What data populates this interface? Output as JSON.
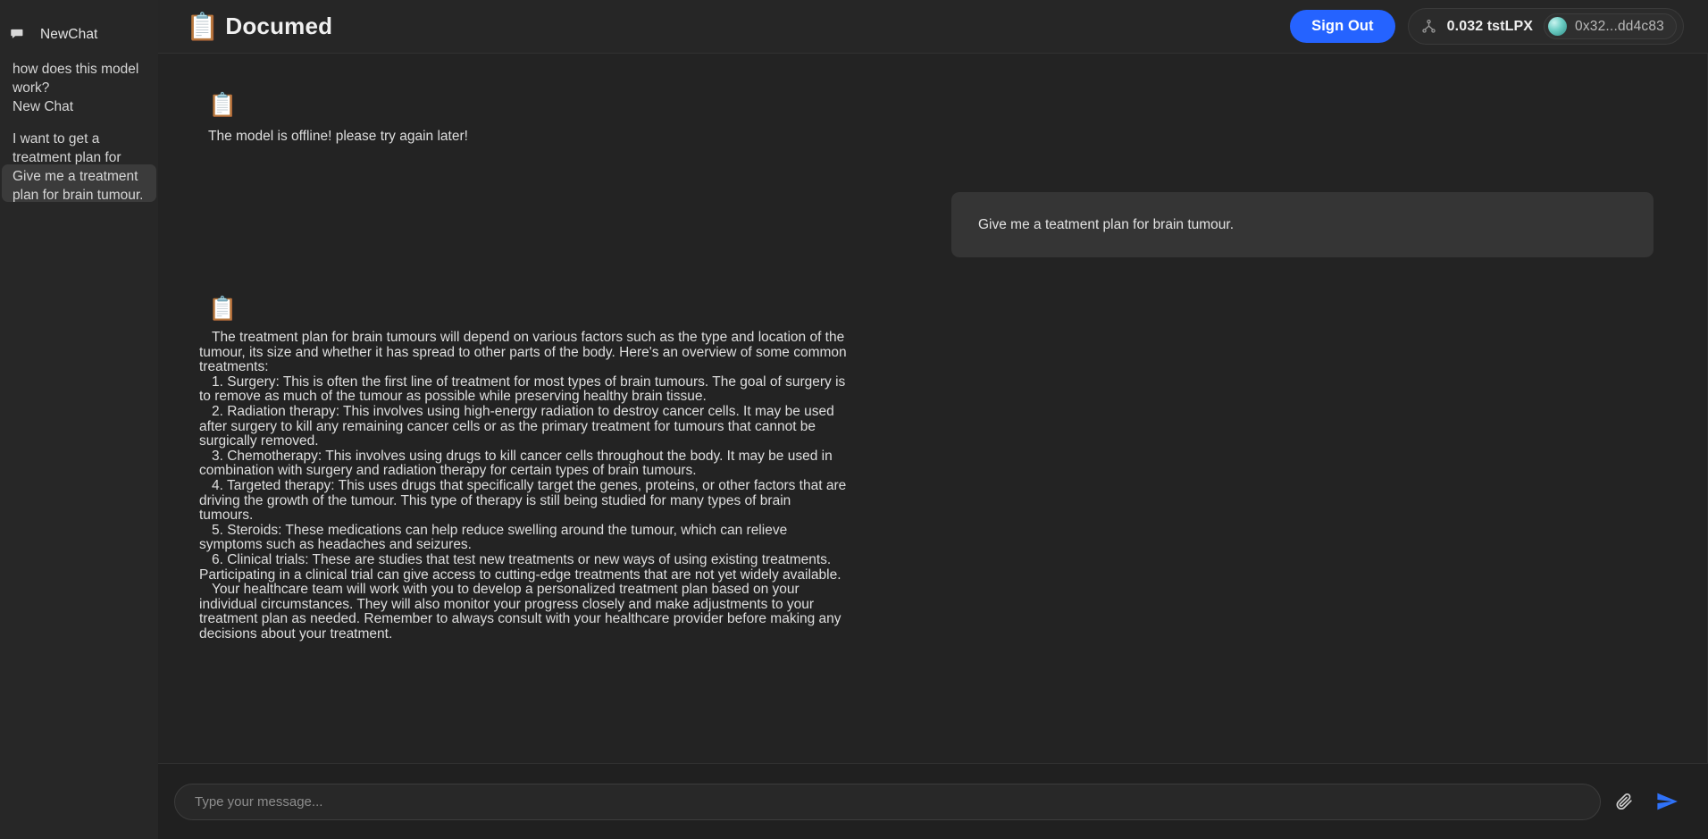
{
  "app": {
    "title": "Documed",
    "logo_icon": "clipboard-emoji",
    "logo_glyph": "📋",
    "accent_color": "#2563ff",
    "background_color": "#202020",
    "panel_color": "#232323",
    "sidebar_color": "#272727"
  },
  "sidebar": {
    "new_chat": {
      "label": "NewChat",
      "icon": "chat-bubble-icon"
    },
    "items": [
      {
        "label": "how does this model work?",
        "active": false
      },
      {
        "label": "New Chat",
        "active": false
      },
      {
        "label": "I want to get a treatment plan for brain tumour.",
        "active": false
      },
      {
        "label": "Give me a treatment plan for brain tumour.",
        "active": true
      }
    ]
  },
  "header": {
    "sign_out_label": "Sign Out",
    "wallet": {
      "network_icon": "network-nodes-icon",
      "balance": "0.032 tstLPX",
      "address": "0x32...dd4c83",
      "avatar_icon": "wallet-avatar"
    }
  },
  "chat": {
    "messages": [
      {
        "role": "assistant",
        "avatar_glyph": "📋",
        "text": "The model is offline! please try again later!"
      },
      {
        "role": "user",
        "text": "Give me a teatment plan for brain tumour."
      },
      {
        "role": "assistant",
        "avatar_glyph": "📋",
        "paragraphs": [
          "The treatment plan for brain tumours will depend on various factors such as the type and location of the tumour, its size and whether it has spread to other parts of the body. Here's an overview of some common treatments:",
          "1. Surgery: This is often the first line of treatment for most types of brain tumours. The goal of surgery is to remove as much of the tumour as possible while preserving healthy brain tissue.",
          "2. Radiation therapy: This involves using high-energy radiation to destroy cancer cells. It may be used after surgery to kill any remaining cancer cells or as the primary treatment for tumours that cannot be surgically removed.",
          "3. Chemotherapy: This involves using drugs to kill cancer cells throughout the body. It may be used in combination with surgery and radiation therapy for certain types of brain tumours.",
          "4. Targeted therapy: This uses drugs that specifically target the genes, proteins, or other factors that are driving the growth of the tumour. This type of therapy is still being studied for many types of brain tumours.",
          "5. Steroids: These medications can help reduce swelling around the tumour, which can relieve symptoms such as headaches and seizures.",
          "6. Clinical trials: These are studies that test new treatments or new ways of using existing treatments. Participating in a clinical trial can give access to cutting-edge treatments that are not yet widely available.",
          "Your healthcare team will work with you to develop a personalized treatment plan based on your individual circumstances. They will also monitor your progress closely and make adjustments to your treatment plan as needed. Remember to always consult with your healthcare provider before making any decisions about your treatment."
        ]
      }
    ]
  },
  "composer": {
    "placeholder": "Type your message...",
    "value": "",
    "attach_icon": "paperclip-icon",
    "send_icon": "send-plane-icon"
  }
}
